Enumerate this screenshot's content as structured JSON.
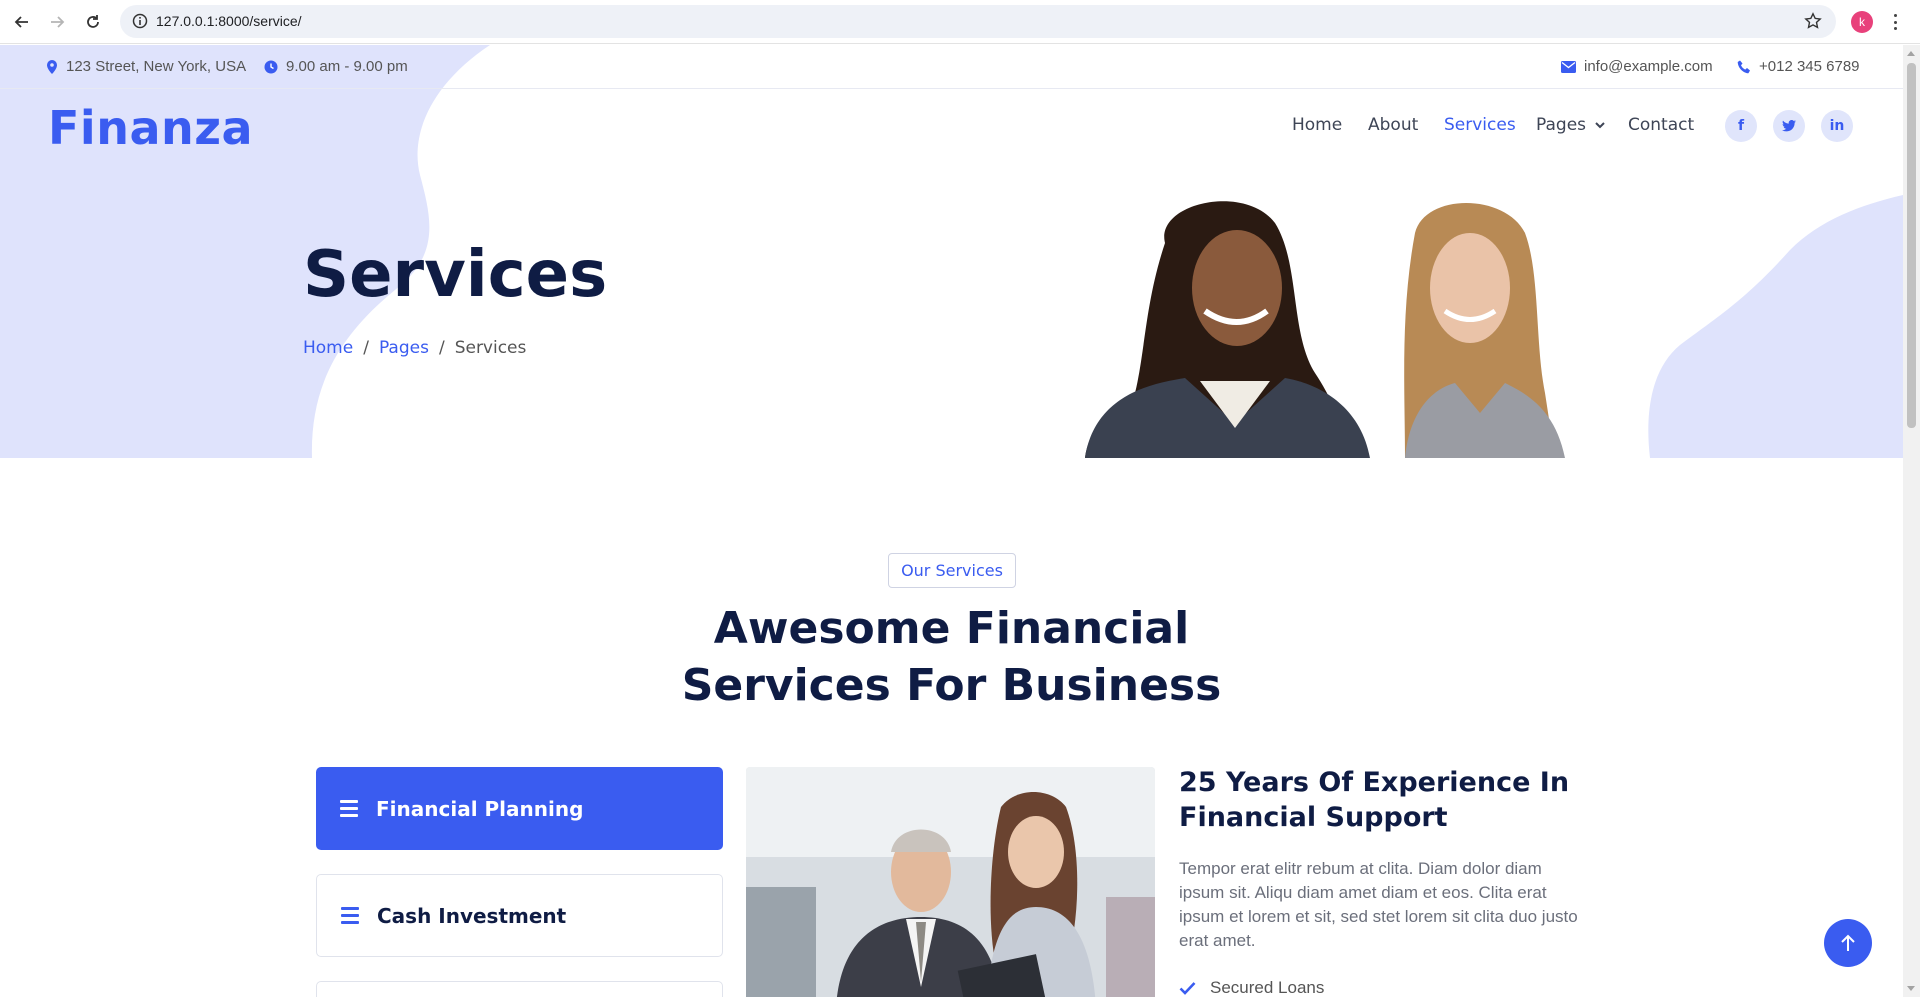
{
  "browser": {
    "url": "127.0.0.1:8000/service/",
    "profile_initial": "k"
  },
  "topbar": {
    "address": "123 Street, New York, USA",
    "hours": "9.00 am - 9.00 pm",
    "email": "info@example.com",
    "phone": "+012 345 6789"
  },
  "brand": {
    "logo": "Finanza",
    "accent": "#3a5cf0",
    "dark": "#0f1c44"
  },
  "nav": {
    "items": [
      "Home",
      "About",
      "Services",
      "Pages",
      "Contact"
    ],
    "active": "Services"
  },
  "social": {
    "facebook": "f",
    "twitter": "t",
    "linkedin": "in"
  },
  "hero": {
    "title": "Services",
    "breadcrumb": [
      "Home",
      "Pages",
      "Services"
    ]
  },
  "services": {
    "tag": "Our Services",
    "title_line1": "Awesome Financial",
    "title_line2": "Services For Business",
    "tabs": [
      "Financial Planning",
      "Cash Investment"
    ],
    "active_tab": "Financial Planning",
    "detail": {
      "title": "25 Years Of Experience In Financial Support",
      "text": "Tempor erat elitr rebum at clita. Diam dolor diam ipsum sit. Aliqu diam amet diam et eos. Clita erat ipsum et lorem et sit, sed stet lorem sit clita duo justo erat amet.",
      "checklist": [
        "Secured Loans"
      ]
    }
  }
}
